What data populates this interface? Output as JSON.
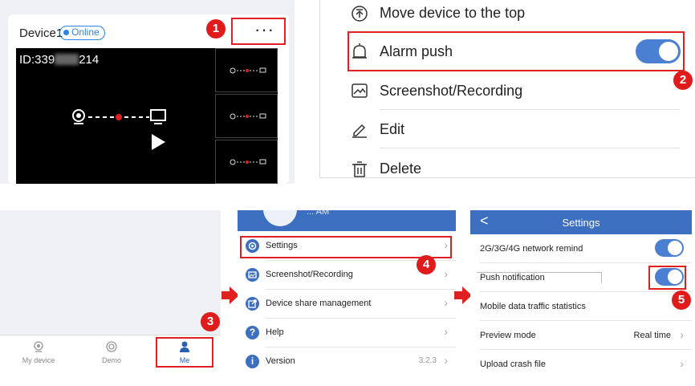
{
  "device_card": {
    "name": "Device1",
    "status": "Online",
    "more_label": "···",
    "video_id": "ID:339",
    "video_id_suffix": "214"
  },
  "action_menu": {
    "items": [
      {
        "label": "Move device to the top",
        "icon": "move-top-icon"
      },
      {
        "label": "Alarm push",
        "icon": "alarm-bell-icon",
        "toggle": true
      },
      {
        "label": "Screenshot/Recording",
        "icon": "image-icon"
      },
      {
        "label": "Edit",
        "icon": "pencil-icon"
      },
      {
        "label": "Delete",
        "icon": "trash-icon"
      }
    ]
  },
  "tabbar": {
    "tabs": [
      {
        "label": "My device",
        "icon": "camera-icon",
        "active": false
      },
      {
        "label": "Demo",
        "icon": "target-icon",
        "active": false
      },
      {
        "label": "Me",
        "icon": "person-icon",
        "active": true
      }
    ]
  },
  "me_menu": {
    "header_fragment": "... AM",
    "items": [
      {
        "label": "Settings",
        "icon": "gear-icon",
        "icon_color": "#3d6fc0"
      },
      {
        "label": "Screenshot/Recording",
        "icon": "image-icon",
        "icon_color": "#3d6fc0"
      },
      {
        "label": "Device share management",
        "icon": "share-icon",
        "icon_color": "#3d6fc0"
      },
      {
        "label": "Help",
        "icon": "help-icon",
        "icon_color": "#3d6fc0"
      },
      {
        "label": "Version",
        "icon": "info-icon",
        "icon_color": "#3d6fc0",
        "value": "3.2.3"
      }
    ]
  },
  "settings_page": {
    "title": "Settings",
    "back_label": "<",
    "rows": [
      {
        "label": "2G/3G/4G network remind",
        "toggle": true
      },
      {
        "label": "Push notification",
        "toggle": true
      },
      {
        "label": "Mobile data traffic statistics"
      },
      {
        "label": "Preview mode",
        "value": "Real time",
        "chevron": true
      },
      {
        "label": "Upload crash file",
        "chevron": true
      }
    ]
  },
  "steps": [
    "1",
    "2",
    "3",
    "4",
    "5"
  ],
  "colors": {
    "accent": "#3d6fc0",
    "highlight": "#e02020",
    "toggle_on": "#4a7fd1"
  }
}
